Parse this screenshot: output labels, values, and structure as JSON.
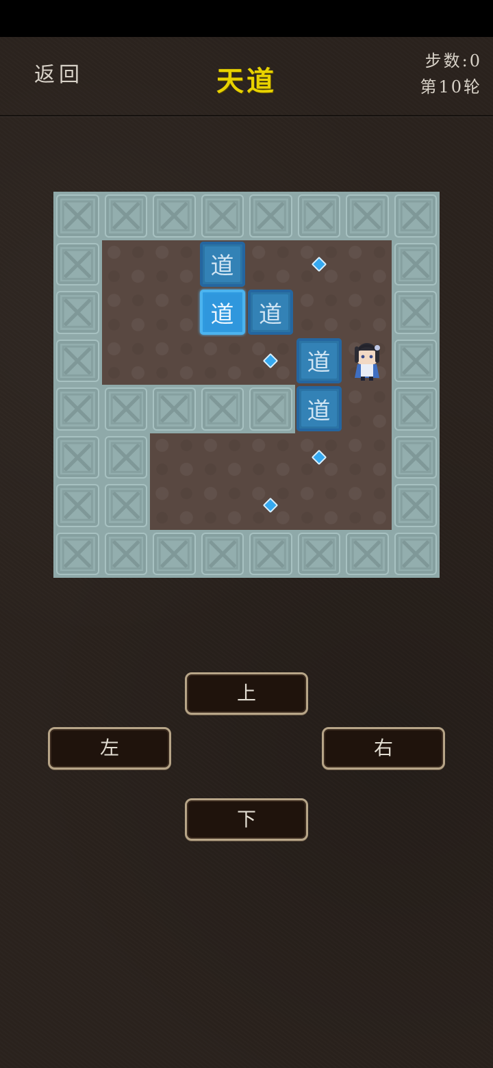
{
  "header": {
    "back_label": "返回",
    "title": "天道",
    "steps_label": "步数:0",
    "round_label": "第10轮"
  },
  "board": {
    "rows": 8,
    "cols": 8,
    "legend": "#=wall, .=floor, B=box, A=highlighted box, T=target, P=player",
    "layout": [
      "########",
      "#..B.T.#",
      "#..AB..#",
      "#...TBP#",
      "#####B.#",
      "##...T.#",
      "##..T..#",
      "########"
    ],
    "box_label": "道"
  },
  "controls": {
    "up_label": "上",
    "left_label": "左",
    "right_label": "右",
    "down_label": "下"
  },
  "colors": {
    "title": "#e8d200",
    "wall": "#93aeae",
    "floor": "#594841",
    "box": "#2b74a5",
    "box_active": "#2f9ae0",
    "target": "#35a9f0",
    "button_bg": "#1f130c",
    "button_border": "#b7a588"
  }
}
